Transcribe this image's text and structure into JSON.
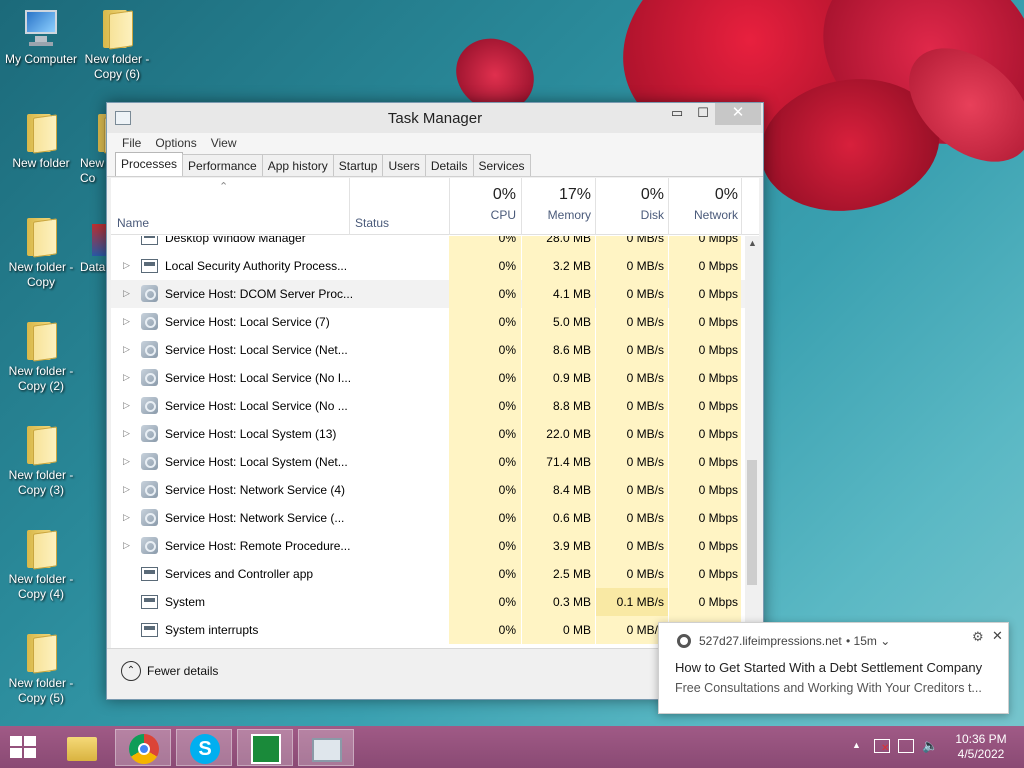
{
  "desktop": {
    "icons": [
      {
        "label": "My Computer",
        "icon": "computer-icon"
      },
      {
        "label": "New folder - Copy (6)",
        "icon": "folder-icon"
      },
      {
        "label": "New folder",
        "icon": "folder-icon"
      },
      {
        "label": "New folder - Copy",
        "icon": "folder-icon"
      },
      {
        "label": "New folder - Copy (2)",
        "icon": "folder-icon"
      },
      {
        "label": "New folder - Copy (3)",
        "icon": "folder-icon"
      },
      {
        "label": "New folder - Copy (4)",
        "icon": "folder-icon"
      },
      {
        "label": "New folder - Copy (5)",
        "icon": "folder-icon"
      }
    ],
    "partial_labels": [
      "New",
      "Co",
      "Data"
    ]
  },
  "task_manager": {
    "title": "Task Manager",
    "window_buttons": {
      "minimize": "▭",
      "maximize": "☐",
      "close": "✕"
    },
    "menu": [
      "File",
      "Options",
      "View"
    ],
    "tabs": [
      "Processes",
      "Performance",
      "App history",
      "Startup",
      "Users",
      "Details",
      "Services"
    ],
    "active_tab": "Processes",
    "columns": {
      "name": "Name",
      "status": "Status",
      "cpu": {
        "pct": "0%",
        "label": "CPU"
      },
      "memory": {
        "pct": "17%",
        "label": "Memory"
      },
      "disk": {
        "pct": "0%",
        "label": "Disk"
      },
      "network": {
        "pct": "0%",
        "label": "Network"
      }
    },
    "processes": [
      {
        "name": "Desktop Window Manager",
        "expandable": false,
        "icon": "window",
        "cpu": "0%",
        "memory": "28.0 MB",
        "disk": "0 MB/s",
        "network": "0 Mbps",
        "partial": true
      },
      {
        "name": "Local Security Authority Process...",
        "expandable": true,
        "icon": "window",
        "cpu": "0%",
        "memory": "3.2 MB",
        "disk": "0 MB/s",
        "network": "0 Mbps"
      },
      {
        "name": "Service Host: DCOM Server Proc...",
        "expandable": true,
        "icon": "gear",
        "cpu": "0%",
        "memory": "4.1 MB",
        "disk": "0 MB/s",
        "network": "0 Mbps",
        "selected": true
      },
      {
        "name": "Service Host: Local Service (7)",
        "expandable": true,
        "icon": "gear",
        "cpu": "0%",
        "memory": "5.0 MB",
        "disk": "0 MB/s",
        "network": "0 Mbps"
      },
      {
        "name": "Service Host: Local Service (Net...",
        "expandable": true,
        "icon": "gear",
        "cpu": "0%",
        "memory": "8.6 MB",
        "disk": "0 MB/s",
        "network": "0 Mbps"
      },
      {
        "name": "Service Host: Local Service (No I...",
        "expandable": true,
        "icon": "gear",
        "cpu": "0%",
        "memory": "0.9 MB",
        "disk": "0 MB/s",
        "network": "0 Mbps"
      },
      {
        "name": "Service Host: Local Service (No ...",
        "expandable": true,
        "icon": "gear",
        "cpu": "0%",
        "memory": "8.8 MB",
        "disk": "0 MB/s",
        "network": "0 Mbps"
      },
      {
        "name": "Service Host: Local System (13)",
        "expandable": true,
        "icon": "gear",
        "cpu": "0%",
        "memory": "22.0 MB",
        "disk": "0 MB/s",
        "network": "0 Mbps"
      },
      {
        "name": "Service Host: Local System (Net...",
        "expandable": true,
        "icon": "gear",
        "cpu": "0%",
        "memory": "71.4 MB",
        "disk": "0 MB/s",
        "network": "0 Mbps"
      },
      {
        "name": "Service Host: Network Service (4)",
        "expandable": true,
        "icon": "gear",
        "cpu": "0%",
        "memory": "8.4 MB",
        "disk": "0 MB/s",
        "network": "0 Mbps"
      },
      {
        "name": "Service Host: Network Service (...",
        "expandable": true,
        "icon": "gear",
        "cpu": "0%",
        "memory": "0.6 MB",
        "disk": "0 MB/s",
        "network": "0 Mbps"
      },
      {
        "name": "Service Host: Remote Procedure...",
        "expandable": true,
        "icon": "gear",
        "cpu": "0%",
        "memory": "3.9 MB",
        "disk": "0 MB/s",
        "network": "0 Mbps"
      },
      {
        "name": "Services and Controller app",
        "expandable": false,
        "icon": "window",
        "cpu": "0%",
        "memory": "2.5 MB",
        "disk": "0 MB/s",
        "network": "0 Mbps"
      },
      {
        "name": "System",
        "expandable": false,
        "icon": "window",
        "cpu": "0%",
        "memory": "0.3 MB",
        "disk": "0.1 MB/s",
        "network": "0 Mbps",
        "disk_highlight": true
      },
      {
        "name": "System interrupts",
        "expandable": false,
        "icon": "window",
        "cpu": "0%",
        "memory": "0 MB",
        "disk": "0 MB/s",
        "network": "0 Mbps"
      }
    ],
    "footer": {
      "label": "Fewer details",
      "icon": "chevron-up-icon"
    }
  },
  "notification": {
    "domain": "527d27.lifeimpressions.net",
    "time": "• 15m ⌄",
    "headline": "How to Get Started With a Debt Settlement Company",
    "body": "Free Consultations and Working With Your Creditors t...",
    "icon": "chrome-icon"
  },
  "taskbar": {
    "apps": [
      {
        "name": "file-explorer",
        "icon": "folder-icon",
        "active": false
      },
      {
        "name": "chrome",
        "icon": "chrome-icon",
        "active": true
      },
      {
        "name": "skype",
        "icon": "skype-icon",
        "active": true
      },
      {
        "name": "stock-app",
        "icon": "chart-icon",
        "active": true
      },
      {
        "name": "task-manager",
        "icon": "task-manager-icon",
        "active": true
      }
    ],
    "clock": {
      "time": "10:36 PM",
      "date": "4/5/2022"
    }
  },
  "colors": {
    "heat_cell": "#fff4c4",
    "heat_cell_deep": "#f9e9a4",
    "taskbar": "#8a4a74",
    "wallpaper_accent": "#d81b3c"
  }
}
